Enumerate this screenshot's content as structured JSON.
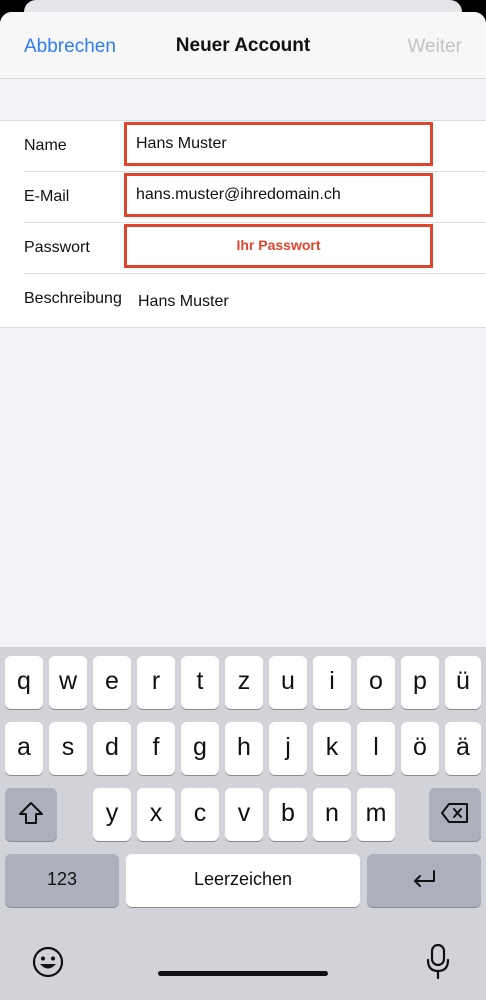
{
  "nav": {
    "cancel": "Abbrechen",
    "title": "Neuer Account",
    "next": "Weiter"
  },
  "form": {
    "name_label": "Name",
    "name_value": "Hans Muster",
    "email_label": "E-Mail",
    "email_value": "hans.muster@ihredomain.ch",
    "password_label": "Passwort",
    "password_hint": "Ihr Passwort",
    "description_label": "Beschreibung",
    "description_value": "Hans Muster"
  },
  "keyboard": {
    "row1": [
      "q",
      "w",
      "e",
      "r",
      "t",
      "z",
      "u",
      "i",
      "o",
      "p",
      "ü"
    ],
    "row2": [
      "a",
      "s",
      "d",
      "f",
      "g",
      "h",
      "j",
      "k",
      "l",
      "ö",
      "ä"
    ],
    "row3": [
      "y",
      "x",
      "c",
      "v",
      "b",
      "n",
      "m"
    ],
    "numbers_label": "123",
    "space_label": "Leerzeichen",
    "icons": {
      "shift": "shift-icon",
      "delete": "delete-icon",
      "return": "return-icon",
      "emoji": "emoji-icon",
      "mic": "microphone-icon"
    }
  },
  "colors": {
    "accent": "#2f7cf6",
    "highlight": "#e0452e",
    "disabled": "#c2c2c7"
  }
}
